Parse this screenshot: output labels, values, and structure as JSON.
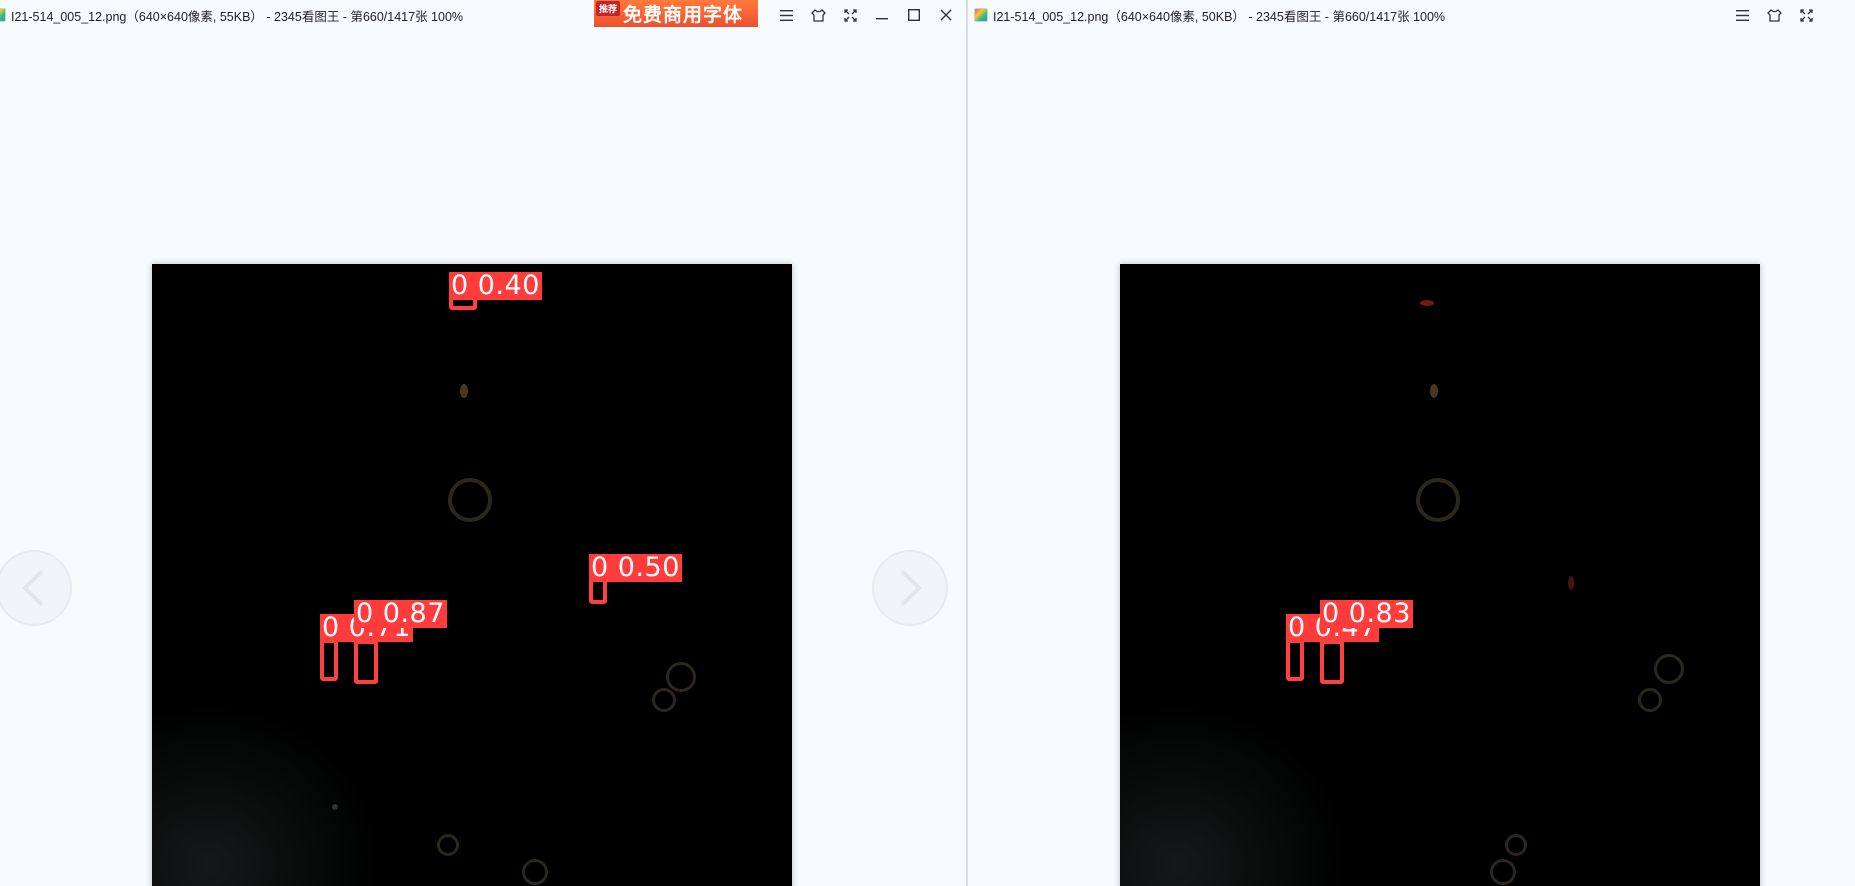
{
  "left_window": {
    "title": "I21-514_005_12.png（640×640像素, 55KB） - 2345看图王 - 第660/1417张 100%",
    "ad": {
      "tag": "推荐",
      "text": "免费商用字体"
    },
    "controls": [
      "menu-icon",
      "skin-icon",
      "fullscreen-icon",
      "minimize-icon",
      "maximize-icon",
      "close-icon"
    ],
    "detections": [
      {
        "label": "0 0.40"
      },
      {
        "label": "0 0.50"
      },
      {
        "label": "0 0.71"
      },
      {
        "label": "0 0.87"
      }
    ],
    "nav": {
      "prev": "chevron-left-icon",
      "next": "chevron-right-icon"
    }
  },
  "right_window": {
    "title": "I21-514_005_12.png（640×640像素, 50KB） - 2345看图王 - 第660/1417张 100%",
    "controls": [
      "menu-icon",
      "skin-icon",
      "fullscreen-icon"
    ],
    "detections": [
      {
        "label": "0 0.47"
      },
      {
        "label": "0 0.83"
      }
    ]
  },
  "colors": {
    "background": "#f6fbfe",
    "detection": "#ff3b3b",
    "ad": "#ef4f2e"
  }
}
